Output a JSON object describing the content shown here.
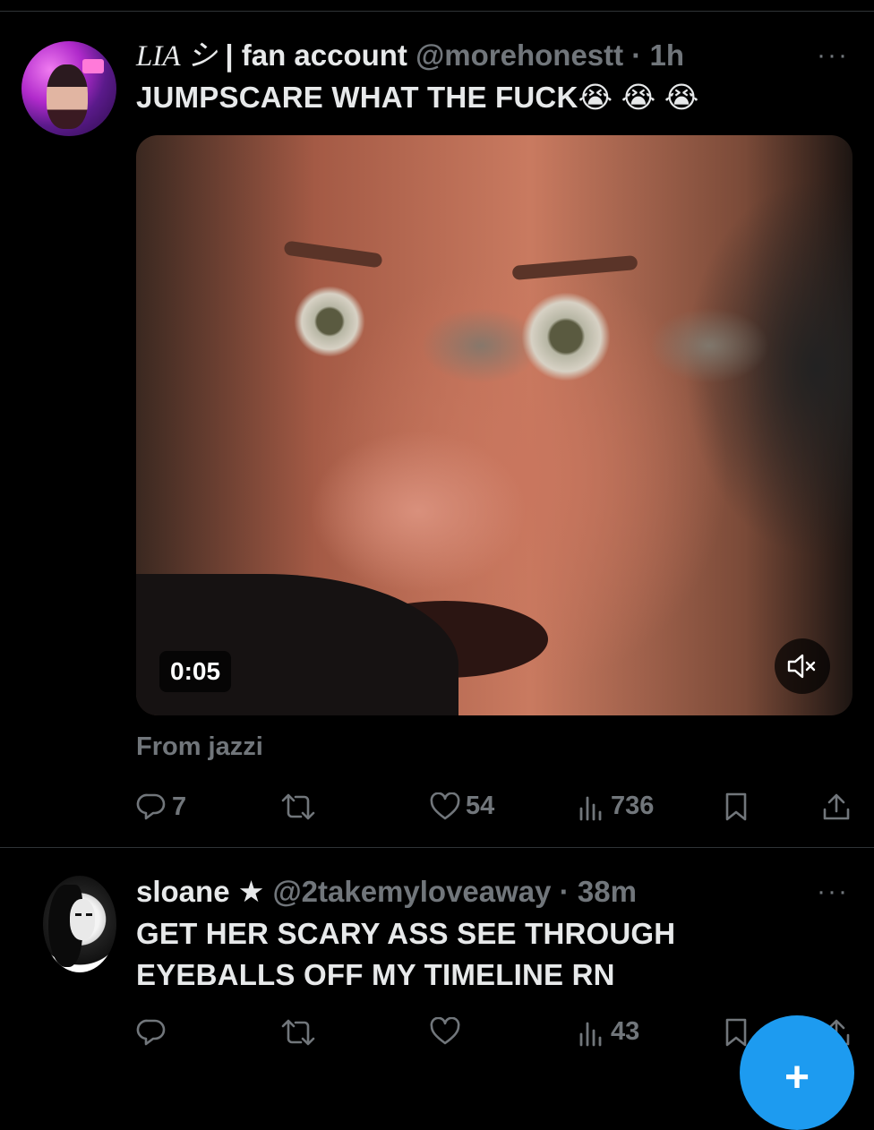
{
  "tweets": [
    {
      "name_main": "LIA シ",
      "name_rest": " | fan account",
      "handle": "@morehonestt",
      "dot": "·",
      "time": "1h",
      "more": "···",
      "text": "JUMPSCARE WHAT THE FUCK😭 😭 😭",
      "video_duration": "0:05",
      "from_text": "From jazzi",
      "replies": "7",
      "retweets": "",
      "likes": "54",
      "views": "736"
    },
    {
      "name": "sloane ★",
      "handle": "@2takemyloveaway",
      "dot": "·",
      "time": "38m",
      "more": "···",
      "text_line1": "GET HER SCARY ASS SEE THROUGH",
      "text_line2": "EYEBALLS OFF MY TIMELINE RN",
      "replies": "",
      "retweets": "",
      "likes": "",
      "views": "43"
    }
  ],
  "fab": {
    "symbol": "+"
  },
  "colors": {
    "background": "#000000",
    "text": "#e7e9ea",
    "muted": "#71767b",
    "accent": "#1d9bf0"
  },
  "icons": [
    "reply-icon",
    "retweet-icon",
    "like-icon",
    "views-icon",
    "bookmark-icon",
    "share-icon",
    "mute-icon",
    "more-icon"
  ]
}
